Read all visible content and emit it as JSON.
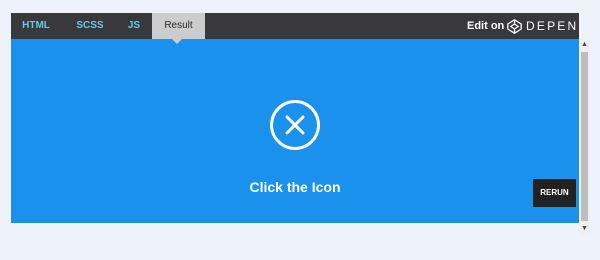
{
  "tabs": [
    {
      "label": "HTML",
      "active": false
    },
    {
      "label": "SCSS",
      "active": false
    },
    {
      "label": "JS",
      "active": false
    },
    {
      "label": "Result",
      "active": true
    }
  ],
  "header": {
    "edit_on": "Edit on",
    "brand": "DEPEN",
    "brand_icon": "codepen-icon"
  },
  "result": {
    "icon": "close-circle-icon",
    "cta": "Click the Icon",
    "rerun": "RERUN"
  },
  "scrollbar": {
    "up": "▲",
    "down": "▼"
  },
  "colors": {
    "result_bg": "#1b91ee",
    "topbar_bg": "#39393b",
    "tab_text": "#6ec4e8",
    "tab_active_bg": "#cccccc",
    "page_bg": "#eef2fa",
    "rerun_bg": "#222222"
  }
}
